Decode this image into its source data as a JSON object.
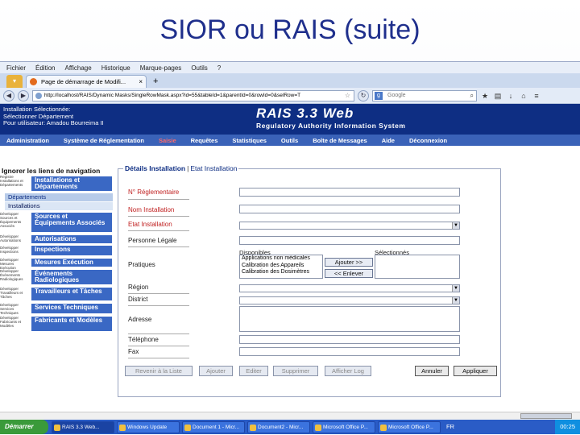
{
  "slide": {
    "title": "SIOR ou RAIS (suite)"
  },
  "browser": {
    "menu": [
      "Fichier",
      "Édition",
      "Affichage",
      "Historique",
      "Marque-pages",
      "Outils",
      "?"
    ],
    "tab_title": "Page de démarrage de Modifi...",
    "url": "http://localhost/RAIS/Dynamic Masks/SingleRowMask.aspx?id=55&tableId=1&parentId=0&rowId=0&selRow=T",
    "search_placeholder": "Google"
  },
  "app": {
    "header_lines": [
      "Installation Sélectionnée:",
      "Sélectionner Département",
      "Pour utilisateur: Amadou Bourreima II"
    ],
    "title": "RAIS 3.3 Web",
    "subtitle": "Regulatory Authority Information System",
    "menu": [
      {
        "label": "Administration",
        "active": false
      },
      {
        "label": "Système de Réglementation",
        "active": false
      },
      {
        "label": "Saisie",
        "active": true
      },
      {
        "label": "Requêtes",
        "active": false
      },
      {
        "label": "Statistiques",
        "active": false
      },
      {
        "label": "Outils",
        "active": false
      },
      {
        "label": "Boîte de Messages",
        "active": false
      },
      {
        "label": "Aide",
        "active": false
      },
      {
        "label": "Déconnexion",
        "active": false
      }
    ]
  },
  "left_nav": {
    "header": "Ignorer les liens de navigation",
    "installations_small": "Registre Installations et Départements",
    "installations_btn": "Installations et Départements",
    "sub_items": [
      "Départements",
      "Installations"
    ],
    "sources_small": "Développer Sources et Équipements Associés",
    "sources_btn": "Sources et Équipements Associés",
    "autorisations_small": "Développer Autorisations",
    "autorisations_btn": "Autorisations",
    "inspections_small": "Développer Inspections",
    "inspections_btn": "Inspections",
    "mesures_small": "Développer Mesures Exécution",
    "mesures_btn": "Mesures Exécution",
    "evenements_small": "Développer Événements Radiologiques",
    "evenements_btn": "Événements Radiologiques",
    "travailleurs_small": "Développer Travailleurs et Tâches",
    "travailleurs_btn": "Travailleurs et Tâches",
    "services_small": "Développer Services Techniques",
    "services_btn": "Services Techniques",
    "fabricants_small": "Développer Fabricants et Modèles",
    "fabricants_btn": "Fabricants et Modèles"
  },
  "form": {
    "tab_active": "Détails Installation",
    "tab_inactive": "Etat Installation",
    "labels": {
      "numero": "N° Réglementaire",
      "nom": "Nom Installation",
      "etat": "Etat Installation",
      "personne": "Personne Légale",
      "pratiques": "Pratiques",
      "region": "Région",
      "district": "District",
      "adresse": "Adresse",
      "telephone": "Téléphone",
      "fax": "Fax"
    },
    "disponibles_label": "Disponibles",
    "selectionnees_label": "Sélectionnés",
    "disponibles": [
      "Applications non médicales",
      "Calibration des Appareils",
      "Calibration des Dosimètres"
    ],
    "add_btn": "Ajouter >>",
    "remove_btn": "<< Enlever",
    "actions": {
      "revenir": "Revenir à la Liste",
      "ajouter": "Ajouter",
      "editer": "Editer",
      "supprimer": "Supprimer",
      "afficher_log": "Afficher Log",
      "annuler": "Annuler",
      "appliquer": "Appliquer"
    }
  },
  "taskbar": {
    "start": "Démarrer",
    "tasks": [
      "RAIS 3.3 Web...",
      "Windows Update",
      "Document 1 - Micr...",
      "Document2 - Micr...",
      "Microsoft Office P...",
      "Microsoft Office P..."
    ],
    "lang": "FR",
    "time": "00:25"
  }
}
